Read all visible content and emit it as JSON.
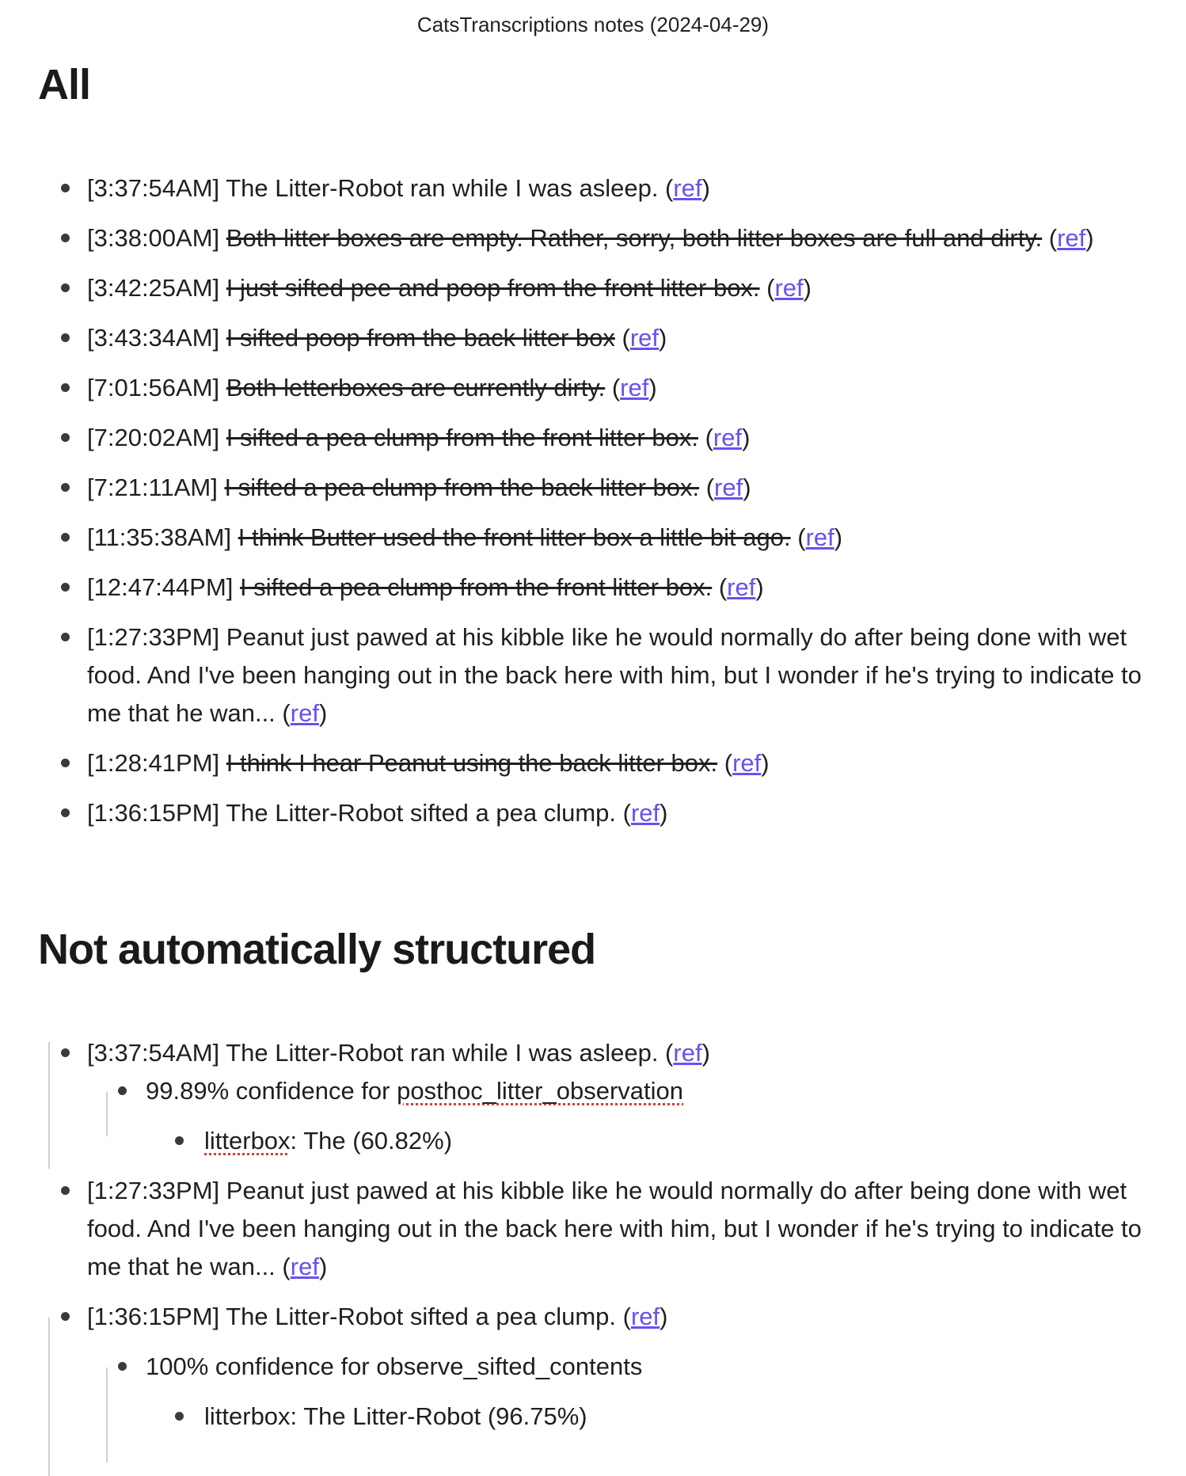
{
  "doc_title": "CatsTranscriptions notes (2024-04-29)",
  "ref_label": "ref",
  "sections": {
    "all": {
      "heading": "All",
      "items": [
        {
          "time": "[3:37:54AM]",
          "text": "The Litter-Robot ran while I was asleep.",
          "struck": false
        },
        {
          "time": "[3:38:00AM]",
          "text": "Both litter boxes are empty. Rather, sorry, both litter boxes are full and dirty.",
          "struck": true
        },
        {
          "time": "[3:42:25AM]",
          "text": "I just sifted pee and poop from the front litter box.",
          "struck": true
        },
        {
          "time": "[3:43:34AM]",
          "text": "I sifted poop from the back litter box",
          "struck": true
        },
        {
          "time": "[7:01:56AM]",
          "text": "Both letterboxes are currently dirty.",
          "struck": true
        },
        {
          "time": "[7:20:02AM]",
          "text": "I sifted a pea clump from the front litter box.",
          "struck": true
        },
        {
          "time": "[7:21:11AM]",
          "text": "I sifted a pea clump from the back litter box.",
          "struck": true
        },
        {
          "time": "[11:35:38AM]",
          "text": "I think Butter used the front litter box a little bit ago.",
          "struck": true
        },
        {
          "time": "[12:47:44PM]",
          "text": "I sifted a pea clump from the front litter box.",
          "struck": true
        },
        {
          "time": "[1:27:33PM]",
          "text": "Peanut just pawed at his kibble like he would normally do after being done with wet food. And I've been hanging out in the back here with him, but I wonder if he's trying to indicate to me that he wan...",
          "struck": false
        },
        {
          "time": "[1:28:41PM]",
          "text": "I think I hear Peanut using the back litter box.",
          "struck": true
        },
        {
          "time": "[1:36:15PM]",
          "text": "The Litter-Robot sifted a pea clump.",
          "struck": false
        }
      ]
    },
    "unstructured": {
      "heading": "Not automatically structured",
      "items": [
        {
          "time": "[3:37:54AM]",
          "text": "The Litter-Robot ran while I was asleep.",
          "confidence": "99.89% confidence for",
          "intent": "posthoc_litter_observation",
          "field_name": "litterbox",
          "field_value": ": The (60.82%)"
        },
        {
          "time": "[1:27:33PM]",
          "text": "Peanut just pawed at his kibble like he would normally do after being done with wet food. And I've been hanging out in the back here with him, but I wonder if he's trying to indicate to me that he wan..."
        },
        {
          "time": "[1:36:15PM]",
          "text": "The Litter-Robot sifted a pea clump.",
          "confidence": "100% confidence for",
          "intent": "observe_sifted_contents",
          "field_name": "litterbox",
          "field_value": ": The Litter-Robot (96.75%)"
        }
      ]
    }
  }
}
